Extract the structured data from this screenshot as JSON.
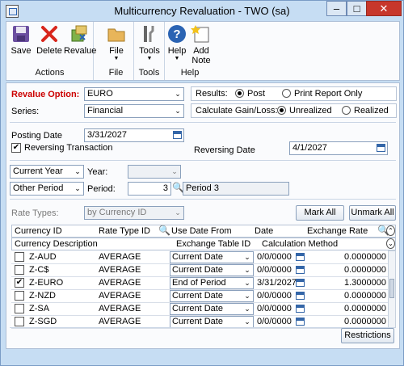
{
  "window": {
    "title": "Multicurrency Revaluation  -  TWO (sa)"
  },
  "colors": {
    "titlebar": "#c6ddf3",
    "close": "#c7372b",
    "required": "#cc0000"
  },
  "ribbon": {
    "actions": {
      "label": "Actions",
      "save": "Save",
      "delete": "Delete",
      "revalue": "Revalue"
    },
    "file": {
      "label": "File",
      "file": "File"
    },
    "tools": {
      "label": "Tools",
      "tools": "Tools"
    },
    "help": {
      "label": "Help",
      "help": "Help",
      "add_note": "Add Note"
    }
  },
  "form": {
    "revalue_option_label": "Revalue Option:",
    "revalue_option_value": "EURO",
    "series_label": "Series:",
    "series_value": "Financial",
    "results_label": "Results:",
    "results_post": "Post",
    "results_print": "Print Report Only",
    "results_selected": "Post",
    "gain_loss_label": "Calculate Gain/Loss:",
    "gain_unrealized": "Unrealized",
    "gain_realized": "Realized",
    "gain_selected": "Unrealized",
    "posting_date_label": "Posting Date",
    "posting_date_value": "3/31/2027",
    "reversing_transaction_label": "Reversing Transaction",
    "reversing_transaction_checked": true,
    "reversing_date_label": "Reversing Date",
    "reversing_date_value": "4/1/2027",
    "year_select": "Current Year",
    "year_label": "Year:",
    "year_value": "",
    "period_select": "Other Period",
    "period_label": "Period:",
    "period_value": "3",
    "period_name": "Period 3",
    "rate_types_label": "Rate Types:",
    "rate_types_value": "by Currency ID",
    "mark_all": "Mark All",
    "unmark_all": "Unmark All",
    "restrictions": "Restrictions"
  },
  "grid": {
    "headers1": [
      "Currency ID",
      "Rate Type ID",
      "Use Date From",
      "Date",
      "Exchange Rate"
    ],
    "headers2": [
      "Currency Description",
      "Exchange Table ID",
      "Calculation Method"
    ],
    "rows": [
      {
        "checked": false,
        "currency": "Z-AUD",
        "rate_type": "AVERAGE",
        "use_date": "Current Date",
        "date": "0/0/0000",
        "rate": "0.0000000"
      },
      {
        "checked": false,
        "currency": "Z-C$",
        "rate_type": "AVERAGE",
        "use_date": "Current Date",
        "date": "0/0/0000",
        "rate": "0.0000000"
      },
      {
        "checked": true,
        "currency": "Z-EURO",
        "rate_type": "AVERAGE",
        "use_date": "End of Period",
        "date": "3/31/2027",
        "rate": "1.3000000"
      },
      {
        "checked": false,
        "currency": "Z-NZD",
        "rate_type": "AVERAGE",
        "use_date": "Current Date",
        "date": "0/0/0000",
        "rate": "0.0000000"
      },
      {
        "checked": false,
        "currency": "Z-SA",
        "rate_type": "AVERAGE",
        "use_date": "Current Date",
        "date": "0/0/0000",
        "rate": "0.0000000"
      },
      {
        "checked": false,
        "currency": "Z-SGD",
        "rate_type": "AVERAGE",
        "use_date": "Current Date",
        "date": "0/0/0000",
        "rate": "0.0000000"
      }
    ]
  }
}
